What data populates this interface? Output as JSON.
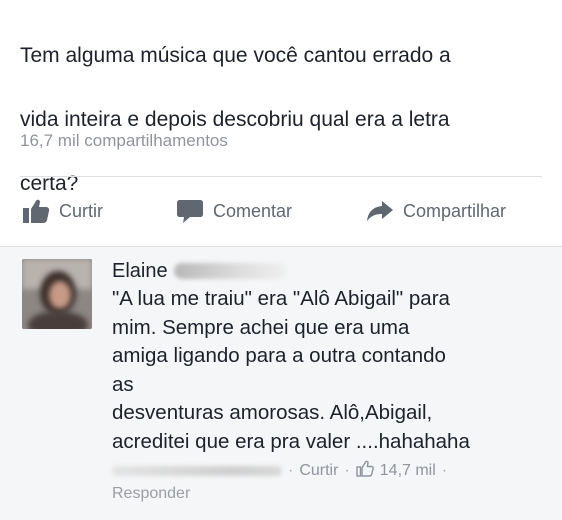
{
  "post": {
    "text_lines": [
      "Tem alguma música que você cantou errado a",
      "vida inteira e depois descobriu qual era a letra",
      "certa?"
    ],
    "shares": "16,7 mil compartilhamentos"
  },
  "actions": {
    "like": "Curtir",
    "comment": "Comentar",
    "share": "Compartilhar"
  },
  "comment": {
    "author": "Elaine",
    "lines": [
      "\"A lua me traiu\" era \"Alô Abigail\" para",
      "mim. Sempre achei que era uma",
      "amiga ligando para a outra contando",
      "as",
      "desventuras amorosas. Alô,Abigail,",
      "acreditei que era pra valer ....hahahaha"
    ],
    "meta": {
      "like_label": "Curtir",
      "separator": "·",
      "like_count": "14,7 mil"
    },
    "reply_label": "Responder"
  },
  "icons": {
    "like": "thumbs-up-icon",
    "comment": "speech-bubble-icon",
    "share": "share-arrow-icon",
    "comment_like": "thumbs-up-outline-icon"
  },
  "colors": {
    "text": "#1d2129",
    "muted": "#90949c",
    "action": "#606770",
    "divider": "#dddfe2"
  }
}
